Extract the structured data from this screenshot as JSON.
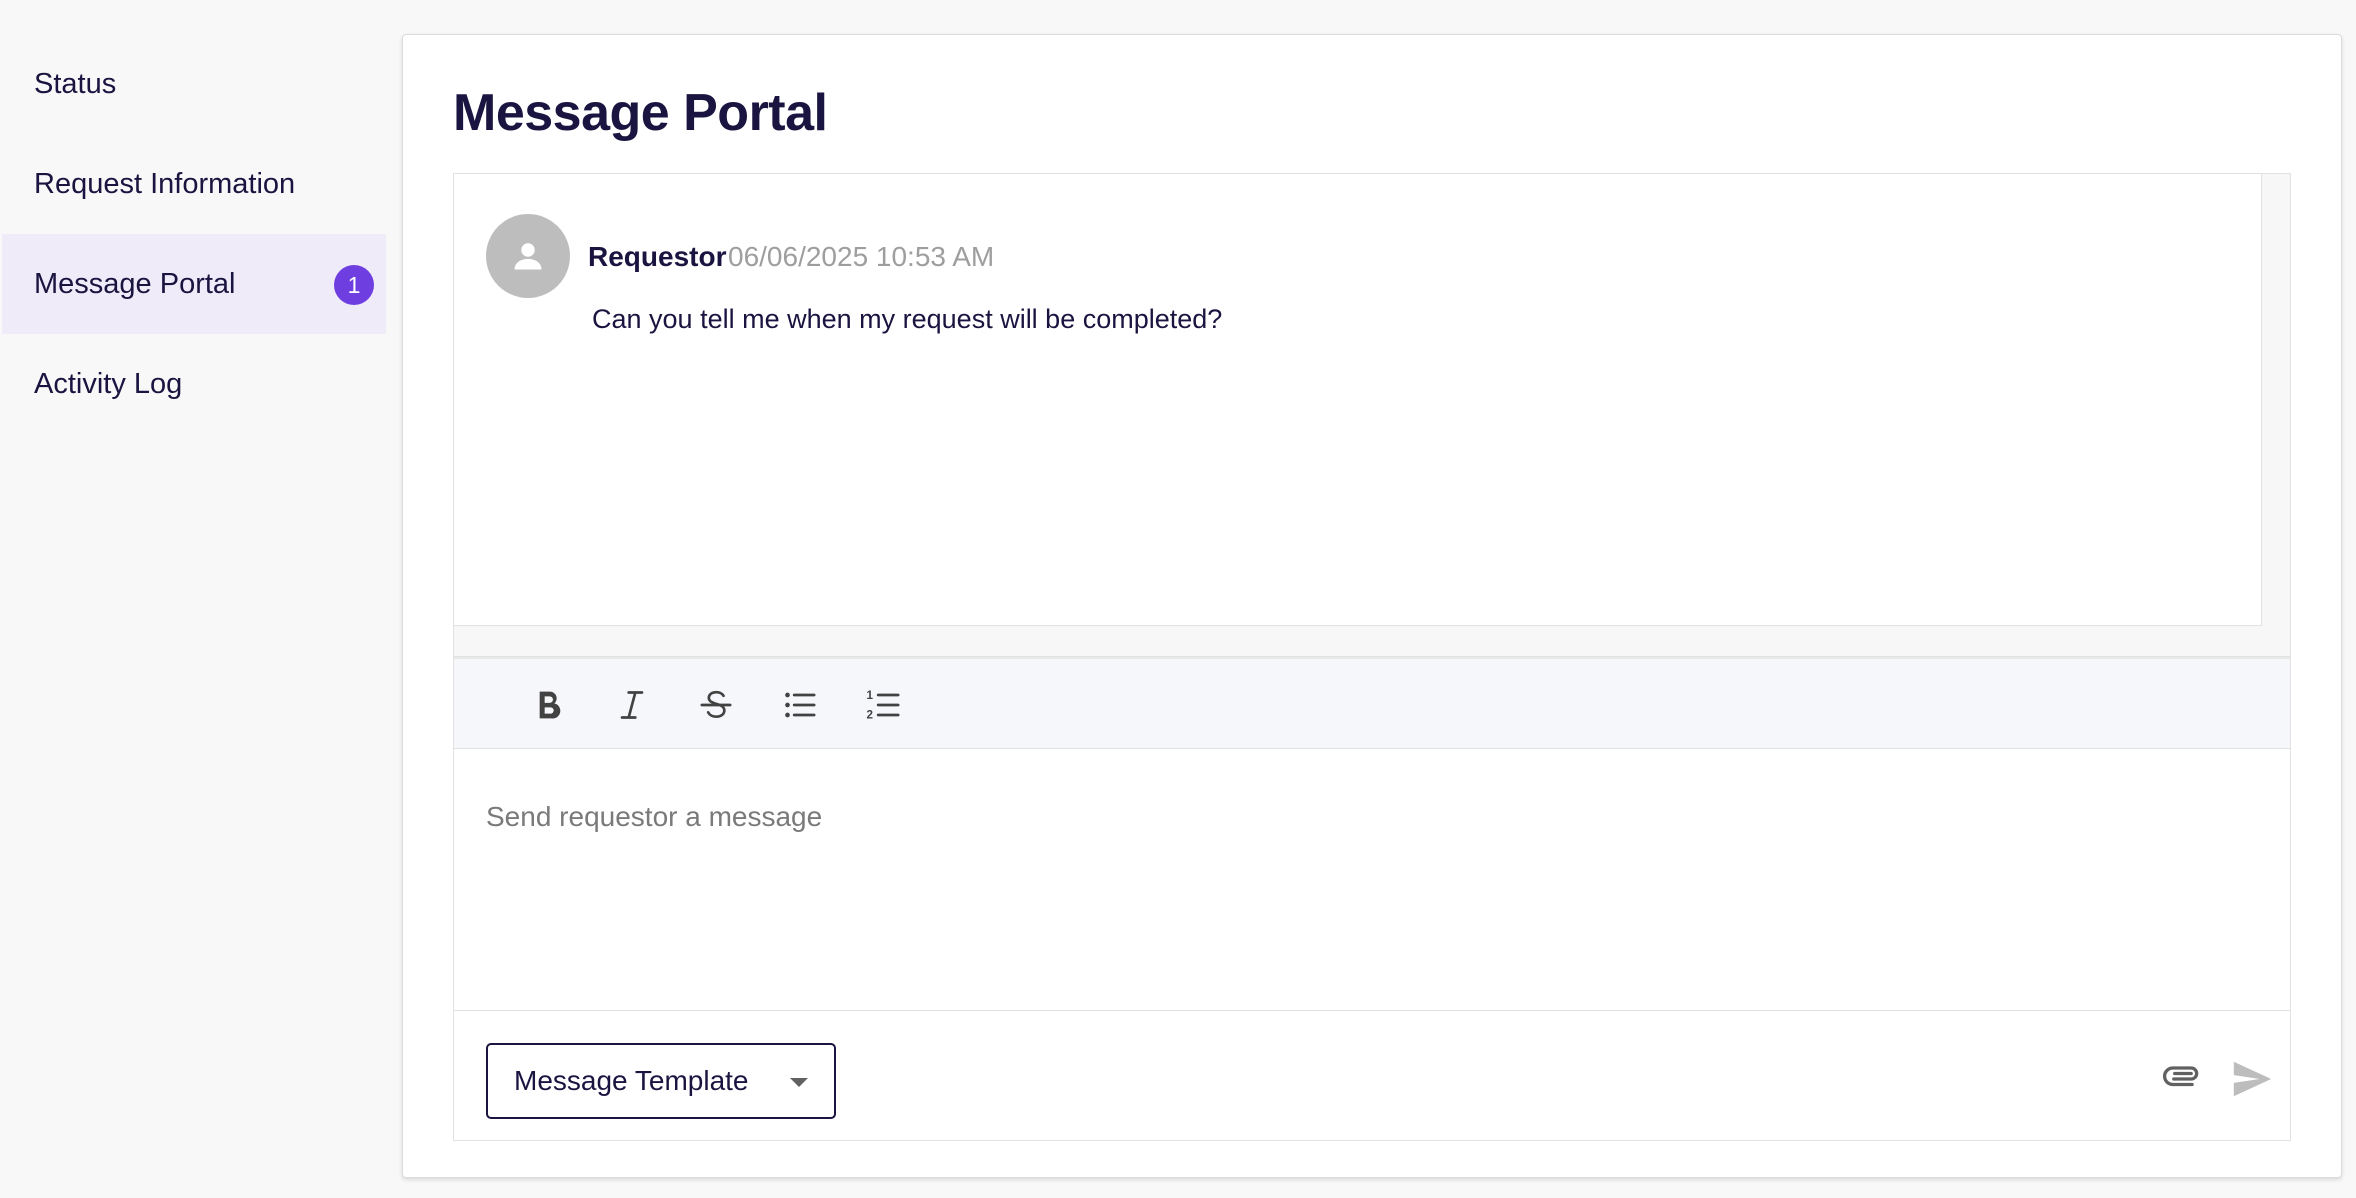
{
  "sidebar": {
    "items": [
      {
        "label": "Status"
      },
      {
        "label": "Request Information"
      },
      {
        "label": "Message Portal",
        "badge": "1",
        "active": true
      },
      {
        "label": "Activity Log"
      }
    ]
  },
  "page": {
    "title": "Message Portal"
  },
  "thread": {
    "messages": [
      {
        "author": "Requestor",
        "timestamp": "06/06/2025 10:53 AM",
        "text": "Can you tell me when my request will be completed?",
        "avatar_icon": "person-icon"
      }
    ]
  },
  "editor": {
    "toolbar": [
      "bold-icon",
      "italic-icon",
      "strikethrough-icon",
      "bullet-list-icon",
      "numbered-list-icon"
    ],
    "placeholder": "Send requestor a message",
    "value": ""
  },
  "footer": {
    "template_select_label": "Message Template",
    "attach_icon": "paperclip-icon",
    "send_icon": "send-icon"
  },
  "colors": {
    "accent": "#6e3ee0",
    "active_bg": "#efebf9",
    "text": "#1a1440"
  }
}
